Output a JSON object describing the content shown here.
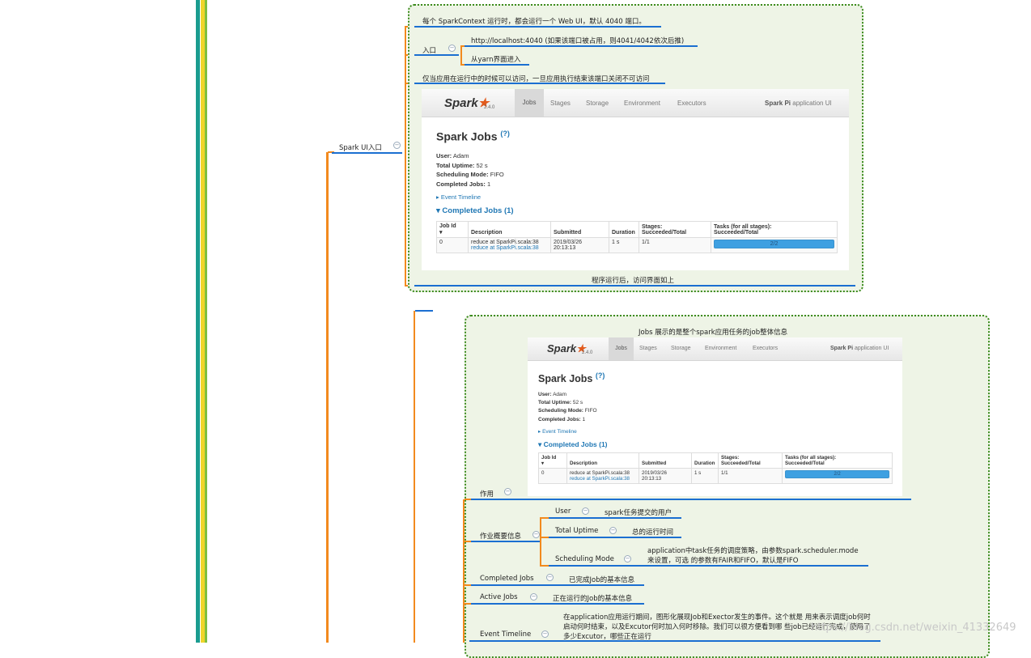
{
  "top_node": {
    "label": "Spark UI入口",
    "items": [
      "每个 SparkContext 运行时，都会运行一个 Web UI，默认 4040 端口。",
      "入口",
      "http://localhost:4040 (如果该端口被占用，则4041/4042依次后推)",
      "从yarn界面进入",
      "仅当应用在运行中的时候可以访问，一旦应用执行结束该端口关闭不可访问",
      "程序运行后，访问界面如上"
    ]
  },
  "spark_ui": {
    "version": "2.4.0",
    "logo_text": "Spark",
    "nav": [
      "Jobs",
      "Stages",
      "Storage",
      "Environment",
      "Executors"
    ],
    "app_name_bold": "Spark Pi",
    "app_name_rest": " application UI",
    "title": "Spark Jobs",
    "help": "(?)",
    "user_label": "User:",
    "user": "Adam",
    "uptime_label": "Total Uptime:",
    "uptime": "52 s",
    "mode_label": "Scheduling Mode:",
    "mode": "FIFO",
    "completed_label": "Completed Jobs:",
    "completed": "1",
    "event_timeline": "▸ Event Timeline",
    "completed_header": "▾ Completed Jobs (1)",
    "table": {
      "headers": [
        "Job Id\n▾",
        "Description",
        "Submitted",
        "Duration",
        "Stages:\nSucceeded/Total",
        "Tasks (for all stages):\nSucceeded/Total"
      ],
      "row": {
        "id": "0",
        "desc1": "reduce at SparkPi.scala:38",
        "desc2": "reduce at SparkPi.scala:38",
        "submitted1": "2019/03/26",
        "submitted2": "20:13:13",
        "duration": "1 s",
        "stages": "1/1",
        "tasks": "2/2"
      }
    }
  },
  "jobs_node": {
    "caption": "Jobs 展示的是整个spark应用任务的job整体信息",
    "purpose": "作用",
    "overview": "作业概要信息",
    "user": "User",
    "user_desc": "spark任务提交的用户",
    "uptime": "Total Uptime",
    "uptime_desc": "总的运行时间",
    "mode": "Scheduling Mode",
    "mode_desc1": "application中task任务的调度策略，由参数spark.scheduler.mode",
    "mode_desc2": "来设置，可选 的参数有FAIR和FIFO，默认是FIFO",
    "completed": "Completed Jobs",
    "completed_desc": "已完成Job的基本信息",
    "active": "Active Jobs",
    "active_desc": "正在运行的Job的基本信息",
    "timeline": "Event Timeline",
    "timeline_desc1": "在application应用运行期间，图形化展现Job和Exector发生的事件。这个就是 用来表示调度job何时",
    "timeline_desc2": "启动何时结束，以及Excutor何时加入何时移除。我们可以很方便看到哪 些job已经运行完成，使用了",
    "timeline_desc3": "多少Excutor，哪些正在运行"
  },
  "watermark": "https://blog.csdn.net/weixin_41332649"
}
